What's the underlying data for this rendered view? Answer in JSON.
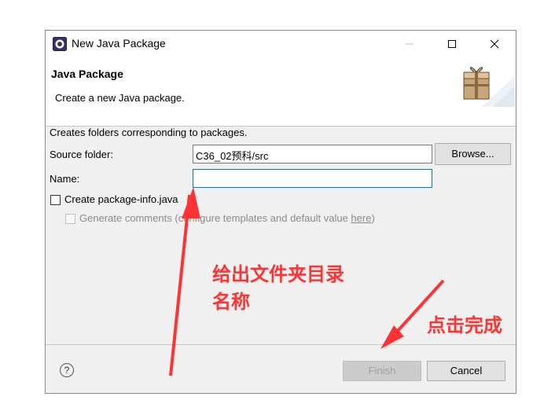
{
  "window": {
    "title": "New Java Package",
    "minimize_icon": "minimize-icon",
    "maximize_icon": "maximize-icon",
    "close_icon": "close-icon"
  },
  "header": {
    "title": "Java Package",
    "description": "Create a new Java package.",
    "image_icon": "package-wizard-icon"
  },
  "body": {
    "info": "Creates folders corresponding to packages.",
    "source_folder_label": "Source folder:",
    "source_folder_value": "C36_02预科/src",
    "browse_label": "Browse...",
    "name_label": "Name:",
    "name_value": "",
    "create_package_info_label": "Create package-info.java",
    "create_package_info_checked": false,
    "generate_comments_prefix": "Generate comments (configure templates and default value ",
    "generate_comments_link": "here",
    "generate_comments_suffix": ")",
    "generate_comments_checked": false,
    "generate_comments_enabled": false
  },
  "footer": {
    "help_icon": "help-icon",
    "help_symbol": "?",
    "finish_label": "Finish",
    "cancel_label": "Cancel"
  },
  "annotations": {
    "name_note_line1": "给出文件夹目录",
    "name_note_line2": "名称",
    "finish_note": "点击完成",
    "color": "#ff3333"
  }
}
